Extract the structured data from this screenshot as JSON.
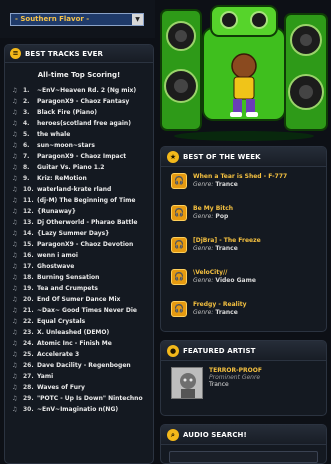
{
  "genre_select": {
    "selected": "- Southern Flavor -"
  },
  "best_tracks": {
    "heading": "BEST TRACKS EVER",
    "subtitle": "All-time Top Scoring!",
    "tracks": [
      {
        "rank": "1.",
        "title": "~EnV~Heaven Rd. 2 (Ng mix)"
      },
      {
        "rank": "2.",
        "title": "ParagonX9 - Chaoz Fantasy"
      },
      {
        "rank": "3.",
        "title": "Black Fire (Piano)"
      },
      {
        "rank": "4.",
        "title": "heroes(scotland free again)"
      },
      {
        "rank": "5.",
        "title": "the whale"
      },
      {
        "rank": "6.",
        "title": "sun~moon~stars"
      },
      {
        "rank": "7.",
        "title": "ParagonX9 - Chaoz Impact"
      },
      {
        "rank": "8.",
        "title": "Guitar Vs. Piano 1.2"
      },
      {
        "rank": "9.",
        "title": "Kriz: ReMotion"
      },
      {
        "rank": "10.",
        "title": "waterland-krate rland"
      },
      {
        "rank": "11.",
        "title": "(dj-M) The Beginning of Time"
      },
      {
        "rank": "12.",
        "title": "{Runaway}"
      },
      {
        "rank": "13.",
        "title": "Dj Otherworld - Pharao Battle"
      },
      {
        "rank": "14.",
        "title": "{Lazy Summer Days}"
      },
      {
        "rank": "15.",
        "title": "ParagonX9 - Chaoz Devotion"
      },
      {
        "rank": "16.",
        "title": "wenn i amoi"
      },
      {
        "rank": "17.",
        "title": "Ghostwave"
      },
      {
        "rank": "18.",
        "title": "Burning Sensation"
      },
      {
        "rank": "19.",
        "title": "Tea and Crumpets"
      },
      {
        "rank": "20.",
        "title": "End Of Sumer Dance Mix"
      },
      {
        "rank": "21.",
        "title": "~Dax~ Good Times Never Die"
      },
      {
        "rank": "22.",
        "title": "Equal Crystals"
      },
      {
        "rank": "23.",
        "title": "X. Unleashed (DEMO)"
      },
      {
        "rank": "24.",
        "title": "Atomic Inc - Finish Me"
      },
      {
        "rank": "25.",
        "title": "Accelerate 3"
      },
      {
        "rank": "26.",
        "title": "Dave Dacility - Regenbogen"
      },
      {
        "rank": "27.",
        "title": "Yami"
      },
      {
        "rank": "28.",
        "title": "Waves of Fury"
      },
      {
        "rank": "29.",
        "title": "\"POTC - Up Is Down\" Nintechno"
      },
      {
        "rank": "30.",
        "title": "~EnV~Imaginatio n(NG)"
      }
    ]
  },
  "best_of_week": {
    "heading": "BEST OF THE WEEK",
    "items": [
      {
        "title": "When a Tear is Shed - F-777",
        "genre_label": "Genre:",
        "genre": "Trance"
      },
      {
        "title": "Be My Bitch",
        "genre_label": "Genre:",
        "genre": "Pop"
      },
      {
        "title": "[DjBra] - The Freeze",
        "genre_label": "Genre:",
        "genre": "Trance"
      },
      {
        "title": "\\VeloCity//",
        "genre_label": "Genre:",
        "genre": "Video Game"
      },
      {
        "title": "Fredgy - Reality",
        "genre_label": "Genre:",
        "genre": "Trance"
      }
    ]
  },
  "featured_artist": {
    "heading": "FEATURED ARTIST",
    "name": "TERROR-PROOF",
    "genre_label": "Prominent Genre",
    "genre": "Trance"
  },
  "audio_search": {
    "heading": "AUDIO SEARCH!"
  },
  "colors": {
    "accent": "#f3b81a",
    "title_yellow": "#f5c140",
    "robot_green": "#3fbf1e"
  }
}
